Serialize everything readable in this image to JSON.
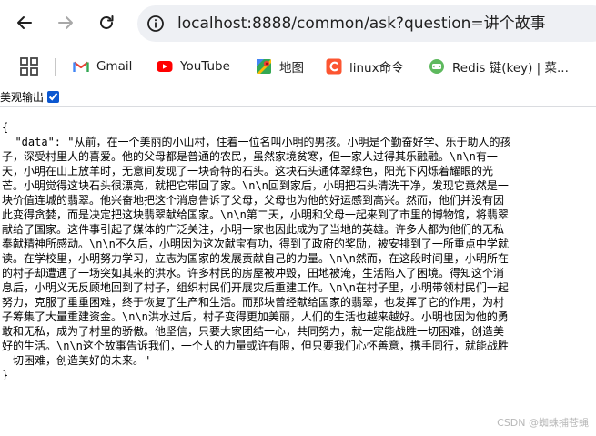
{
  "browser": {
    "url": "localhost:8888/common/ask?question=讲个故事",
    "bookmarks": [
      {
        "label": "Gmail",
        "icon": "gmail-icon"
      },
      {
        "label": "YouTube",
        "icon": "youtube-icon"
      },
      {
        "label": "地图",
        "icon": "maps-icon"
      },
      {
        "label": "linux命令",
        "icon": "c-icon"
      },
      {
        "label": "Redis 键(key) | 菜...",
        "icon": "redis-site-icon"
      }
    ]
  },
  "page": {
    "pretty_label": "美观输出",
    "pretty_checked": true,
    "json_lines": [
      "{",
      "  \"data\": \"从前，在一个美丽的小山村，住着一位名叫小明的男孩。小明是个勤奋好学、乐于助人的孩",
      "子，深受村里人的喜爱。他的父母都是普通的农民，虽然家境贫寒，但一家人过得其乐融融。\\n\\n有一",
      "天，小明在山上放羊时，无意间发现了一块奇特的石头。这块石头通体翠绿色，阳光下闪烁着耀眼的光",
      "芒。小明觉得这块石头很漂亮，就把它带回了家。\\n\\n回到家后，小明把石头清洗干净，发现它竟然是一",
      "块价值连城的翡翠。他兴奋地把这个消息告诉了父母，父母也为他的好运感到高兴。然而，他们并没有因",
      "此变得贪婪，而是决定把这块翡翠献给国家。\\n\\n第二天，小明和父母一起来到了市里的博物馆，将翡翠",
      "献给了国家。这件事引起了媒体的广泛关注，小明一家也因此成为了当地的英雄。许多人都为他们的无私",
      "奉献精神所感动。\\n\\n不久后，小明因为这次献宝有功，得到了政府的奖励，被安排到了一所重点中学就",
      "读。在学校里，小明努力学习，立志为国家的发展贡献自己的力量。\\n\\n然而，在这段时间里，小明所在",
      "的村子却遭遇了一场突如其来的洪水。许多村民的房屋被冲毁，田地被淹，生活陷入了困境。得知这个消",
      "息后，小明义无反顾地回到了村子，组织村民们开展灾后重建工作。\\n\\n在村子里，小明带领村民们一起",
      "努力，克服了重重困难，终于恢复了生产和生活。而那块曾经献给国家的翡翠，也发挥了它的作用，为村",
      "子筹集了大量重建资金。\\n\\n洪水过后，村子变得更加美丽，人们的生活也越来越好。小明也因为他的勇",
      "敢和无私，成为了村里的骄傲。他坚信，只要大家团结一心，共同努力，就一定能战胜一切困难，创造美",
      "好的生活。\\n\\n这个故事告诉我们，一个人的力量或许有限，但只要我们心怀善意，携手同行，就能战胜",
      "一切困难，创造美好的未来。\"",
      "}"
    ]
  },
  "watermark": "CSDN @蜘蛛捕苍蝇"
}
